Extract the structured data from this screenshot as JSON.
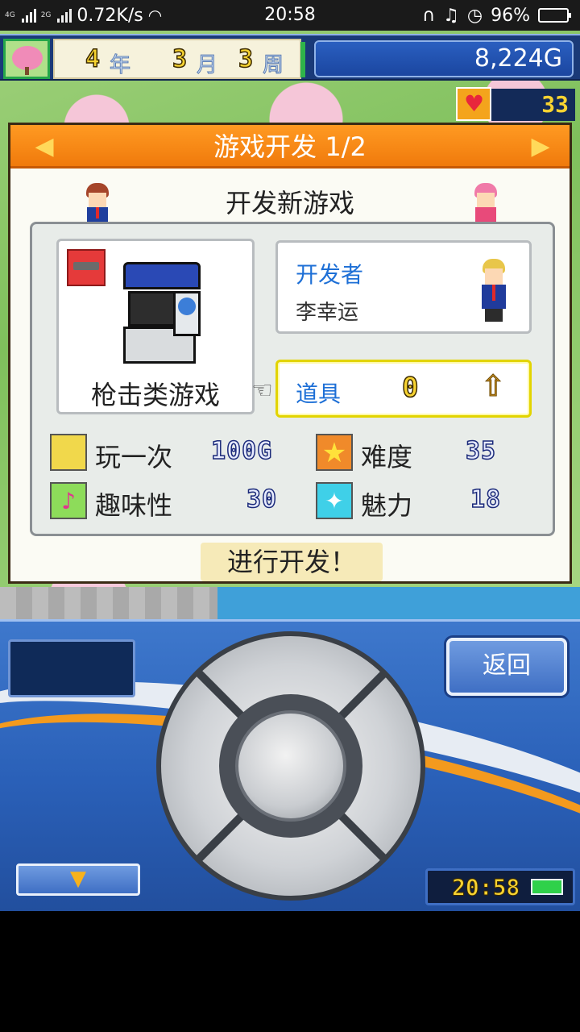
{
  "statusbar": {
    "net1": "4G",
    "net2": "2G",
    "speed": "0.72K/s",
    "time": "20:58",
    "battery": "96%",
    "battery_level": 0.96
  },
  "topbar": {
    "year": "4",
    "year_unit": "年",
    "month": "3",
    "month_unit": "月",
    "week": "3",
    "week_unit": "周",
    "money": "8,224G",
    "hearts": "33"
  },
  "dialog": {
    "title": "游戏开发 1/2",
    "subtitle": "开发新游戏",
    "genre": "枪击类游戏",
    "developer_label": "开发者",
    "developer_name": "李幸运",
    "item_label": "道具",
    "item_count": "0",
    "stats": {
      "play_label": "玩一次",
      "play_value": "100G",
      "difficulty_label": "难度",
      "difficulty_value": "35",
      "fun_label": "趣味性",
      "fun_value": "30",
      "charm_label": "魅力",
      "charm_value": "18"
    },
    "confirm": "进行开发！"
  },
  "pad": {
    "back_label": "返回",
    "clock": "20:58"
  },
  "icons": {
    "prev": "left-triangle",
    "next": "right-triangle",
    "pointer": "hand-pointer",
    "up": "up-arrow",
    "down": "down-triangle"
  }
}
